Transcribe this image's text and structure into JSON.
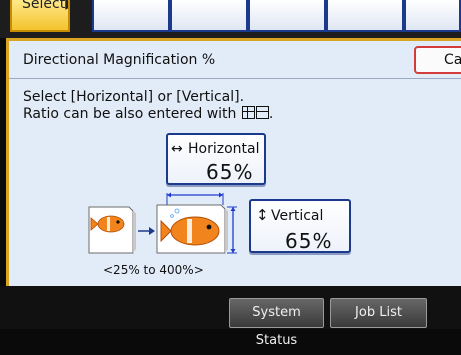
{
  "top_tabs": {
    "select_label": "Select▶"
  },
  "panel": {
    "title": "Directional Magnification %",
    "cancel_label": "Cancel",
    "instruction_line1": "Select [Horizontal] or [Vertical].",
    "instruction_line2": "Ratio can be also entered with"
  },
  "horizontal": {
    "label": "Horizontal",
    "value": "65%"
  },
  "vertical": {
    "label": "Vertical",
    "value": "65%"
  },
  "range_text": "<25% to 400%>",
  "bottom_bar": {
    "system_status": "System Status",
    "job_list": "Job List"
  }
}
